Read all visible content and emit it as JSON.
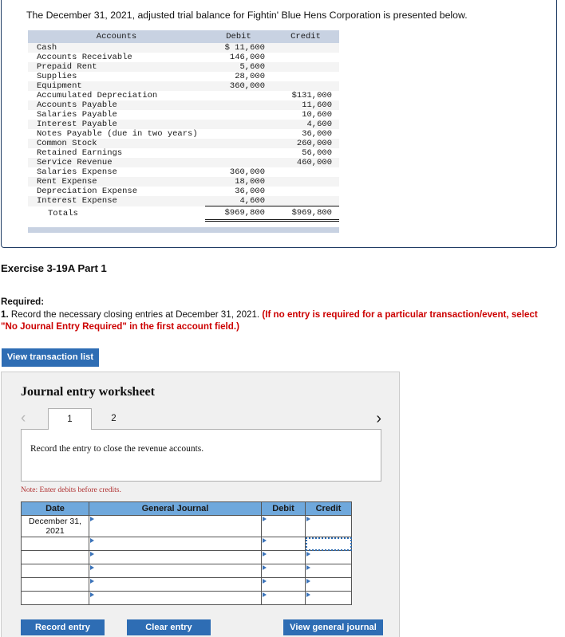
{
  "trial_balance_card": {
    "intro": "The December 31, 2021, adjusted trial balance for Fightin' Blue Hens Corporation is presented below.",
    "columns": [
      "Accounts",
      "Debit",
      "Credit"
    ],
    "rows": [
      {
        "account": "Cash",
        "debit": "$ 11,600",
        "credit": ""
      },
      {
        "account": "Accounts Receivable",
        "debit": "146,000",
        "credit": ""
      },
      {
        "account": "Prepaid Rent",
        "debit": "5,600",
        "credit": ""
      },
      {
        "account": "Supplies",
        "debit": "28,000",
        "credit": ""
      },
      {
        "account": "Equipment",
        "debit": "360,000",
        "credit": ""
      },
      {
        "account": "Accumulated Depreciation",
        "debit": "",
        "credit": "$131,000"
      },
      {
        "account": "Accounts Payable",
        "debit": "",
        "credit": "11,600"
      },
      {
        "account": "Salaries Payable",
        "debit": "",
        "credit": "10,600"
      },
      {
        "account": "Interest Payable",
        "debit": "",
        "credit": "4,600"
      },
      {
        "account": "Notes Payable (due in two years)",
        "debit": "",
        "credit": "36,000"
      },
      {
        "account": "Common Stock",
        "debit": "",
        "credit": "260,000"
      },
      {
        "account": "Retained Earnings",
        "debit": "",
        "credit": "56,000"
      },
      {
        "account": "Service Revenue",
        "debit": "",
        "credit": "460,000"
      },
      {
        "account": "Salaries Expense",
        "debit": "360,000",
        "credit": ""
      },
      {
        "account": "Rent Expense",
        "debit": "18,000",
        "credit": ""
      },
      {
        "account": "Depreciation Expense",
        "debit": "36,000",
        "credit": ""
      },
      {
        "account": "Interest Expense",
        "debit": "4,600",
        "credit": ""
      }
    ],
    "totals": {
      "label": "Totals",
      "debit": "$969,800",
      "credit": "$969,800"
    }
  },
  "exercise": {
    "title": "Exercise 3-19A Part 1",
    "required_label": "Required:",
    "requirement_number": "1.",
    "requirement_text": " Record the necessary closing entries at December 31, 2021. ",
    "requirement_note": "(If no entry is required for a particular transaction/event, select \"No Journal Entry Required\" in the first account field.)"
  },
  "buttons": {
    "view_transaction_list": "View transaction list",
    "record_entry": "Record entry",
    "clear_entry": "Clear entry",
    "view_general_journal": "View general journal"
  },
  "worksheet": {
    "title": "Journal entry worksheet",
    "prev_arrow": "‹",
    "next_arrow": "›",
    "tabs": [
      {
        "label": "1",
        "active": true
      },
      {
        "label": "2",
        "active": false
      }
    ],
    "instruction": "Record the entry to close the revenue accounts.",
    "note": "Note: Enter debits before credits.",
    "journal": {
      "columns": [
        "Date",
        "General Journal",
        "Debit",
        "Credit"
      ],
      "rows": [
        {
          "date": "December 31, 2021",
          "general_journal": "",
          "debit": "",
          "credit": ""
        },
        {
          "date": "",
          "general_journal": "",
          "debit": "",
          "credit": ""
        },
        {
          "date": "",
          "general_journal": "",
          "debit": "",
          "credit": ""
        },
        {
          "date": "",
          "general_journal": "",
          "debit": "",
          "credit": ""
        },
        {
          "date": "",
          "general_journal": "",
          "debit": "",
          "credit": ""
        },
        {
          "date": "",
          "general_journal": "",
          "debit": "",
          "credit": ""
        }
      ]
    }
  },
  "colors": {
    "card_border": "#1f3c64",
    "tb_header_bg": "#c8d2e2",
    "je_header_bg": "#6fa8dc",
    "button_blue": "#2e6db4",
    "required_red": "#cc0000",
    "note_red": "#b03030",
    "panel_bg": "#f0f0f0"
  }
}
